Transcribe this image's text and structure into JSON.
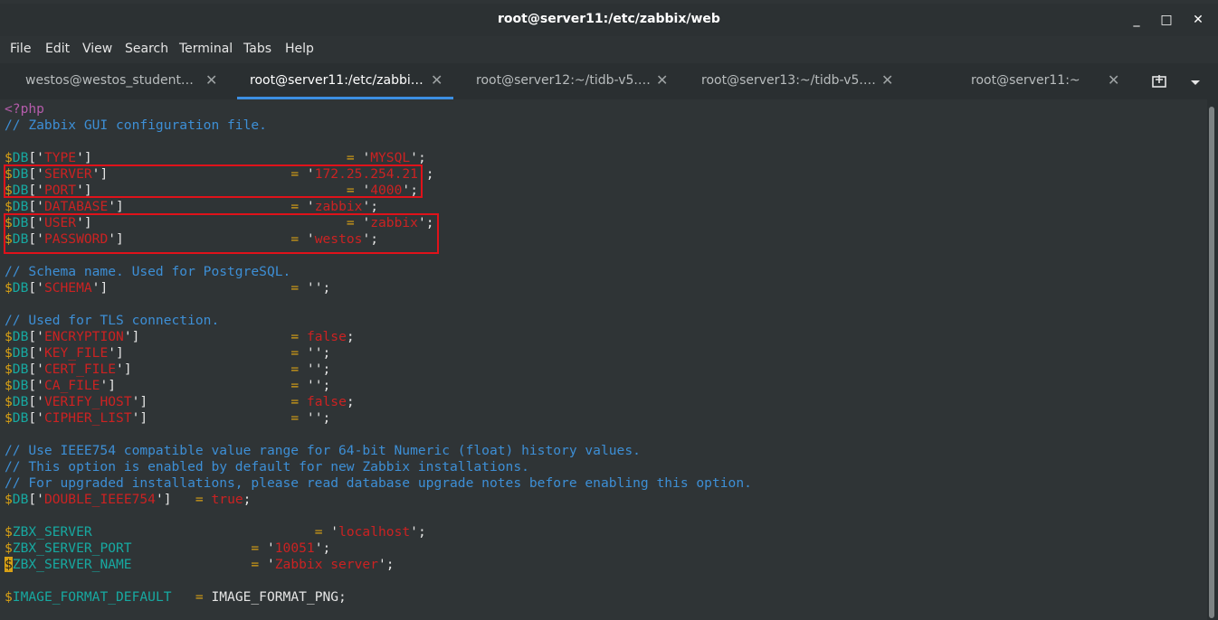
{
  "window": {
    "title": "root@server11:/etc/zabbix/web",
    "minimize": "_",
    "maximize": "□",
    "close": "✕"
  },
  "menu": [
    "File",
    "Edit",
    "View",
    "Search",
    "Terminal",
    "Tabs",
    "Help"
  ],
  "tabs": [
    {
      "label": "westos@westos_student…",
      "close": "✕"
    },
    {
      "label": "root@server11:/etc/zabbi…",
      "close": "✕"
    },
    {
      "label": "root@server12:~/tidb-v5.…",
      "close": "✕"
    },
    {
      "label": "root@server13:~/tidb-v5.…",
      "close": "✕"
    },
    {
      "label": "root@server11:~",
      "close": "✕"
    }
  ],
  "tab_tools": {
    "new_tab": "⊞",
    "menu": "▾"
  },
  "code": [
    {
      "t": "<?php",
      "c": "php"
    },
    {
      "t": "// Zabbix GUI configuration file.",
      "c": "com"
    },
    {
      "t": "",
      "c": "txt"
    },
    {
      "v": "$DB",
      "k": "TYPE",
      "pad": "]                                ",
      "eq": "= ",
      "val": "MYSQL",
      "end": ";"
    },
    {
      "v": "$DB",
      "k": "SERVER",
      "pad": "]                       ",
      "eq": "= ",
      "val": "172.25.254.21",
      "end": ";"
    },
    {
      "v": "$DB",
      "k": "PORT",
      "pad": "]                                ",
      "eq": "= ",
      "val": "4000",
      "end": ";"
    },
    {
      "v": "$DB",
      "k": "DATABASE",
      "pad": "]                     ",
      "eq": "= ",
      "val": "zabbix",
      "end": ";"
    },
    {
      "v": "$DB",
      "k": "USER",
      "pad": "]                                ",
      "eq": "= ",
      "val": "zabbix",
      "end": ";"
    },
    {
      "v": "$DB",
      "k": "PASSWORD",
      "pad": "]                     ",
      "eq": "= ",
      "val": "westos",
      "end": ";"
    },
    {
      "t": "",
      "c": "txt"
    },
    {
      "t": "// Schema name. Used for PostgreSQL.",
      "c": "com"
    },
    {
      "v": "$DB",
      "k": "SCHEMA",
      "pad": "]                       ",
      "eq": "= ",
      "raw": "''",
      "end": ";"
    },
    {
      "t": "",
      "c": "txt"
    },
    {
      "t": "// Used for TLS connection.",
      "c": "com"
    },
    {
      "v": "$DB",
      "k": "ENCRYPTION",
      "pad": "]                   ",
      "eq": "= ",
      "kw": "false",
      "end": ";"
    },
    {
      "v": "$DB",
      "k": "KEY_FILE",
      "pad": "]                     ",
      "eq": "= ",
      "raw": "''",
      "end": ";"
    },
    {
      "v": "$DB",
      "k": "CERT_FILE",
      "pad": "]                    ",
      "eq": "= ",
      "raw": "''",
      "end": ";"
    },
    {
      "v": "$DB",
      "k": "CA_FILE",
      "pad": "]                      ",
      "eq": "= ",
      "raw": "''",
      "end": ";"
    },
    {
      "v": "$DB",
      "k": "VERIFY_HOST",
      "pad": "]                  ",
      "eq": "= ",
      "kw": "false",
      "end": ";"
    },
    {
      "v": "$DB",
      "k": "CIPHER_LIST",
      "pad": "]                  ",
      "eq": "= ",
      "raw": "''",
      "end": ";"
    },
    {
      "t": "",
      "c": "txt"
    },
    {
      "t": "// Use IEEE754 compatible value range for 64-bit Numeric (float) history values.",
      "c": "com"
    },
    {
      "t": "// This option is enabled by default for new Zabbix installations.",
      "c": "com"
    },
    {
      "t": "// For upgraded installations, please read database upgrade notes before enabling this option.",
      "c": "com"
    },
    {
      "v": "$DB",
      "k": "DOUBLE_IEEE754",
      "pad": "]   ",
      "eq": "= ",
      "kw": "true",
      "end": ";"
    },
    {
      "t": "",
      "c": "txt"
    },
    {
      "plain": "$ZBX_SERVER",
      "pad": "                            ",
      "eq": "= ",
      "val": "localhost",
      "end": ";"
    },
    {
      "plain": "$ZBX_SERVER_PORT",
      "pad": "               ",
      "eq": "= ",
      "val": "10051",
      "end": ";"
    },
    {
      "plain": "$ZBX_SERVER_NAME",
      "pad": "               ",
      "eq": "= ",
      "val": "Zabbix server",
      "end": ";",
      "cursor": true
    },
    {
      "t": "",
      "c": "txt"
    },
    {
      "plain": "$IMAGE_FORMAT_DEFAULT",
      "pad": "   ",
      "eq": "= ",
      "rest": "IMAGE_FORMAT_PNG;"
    }
  ]
}
